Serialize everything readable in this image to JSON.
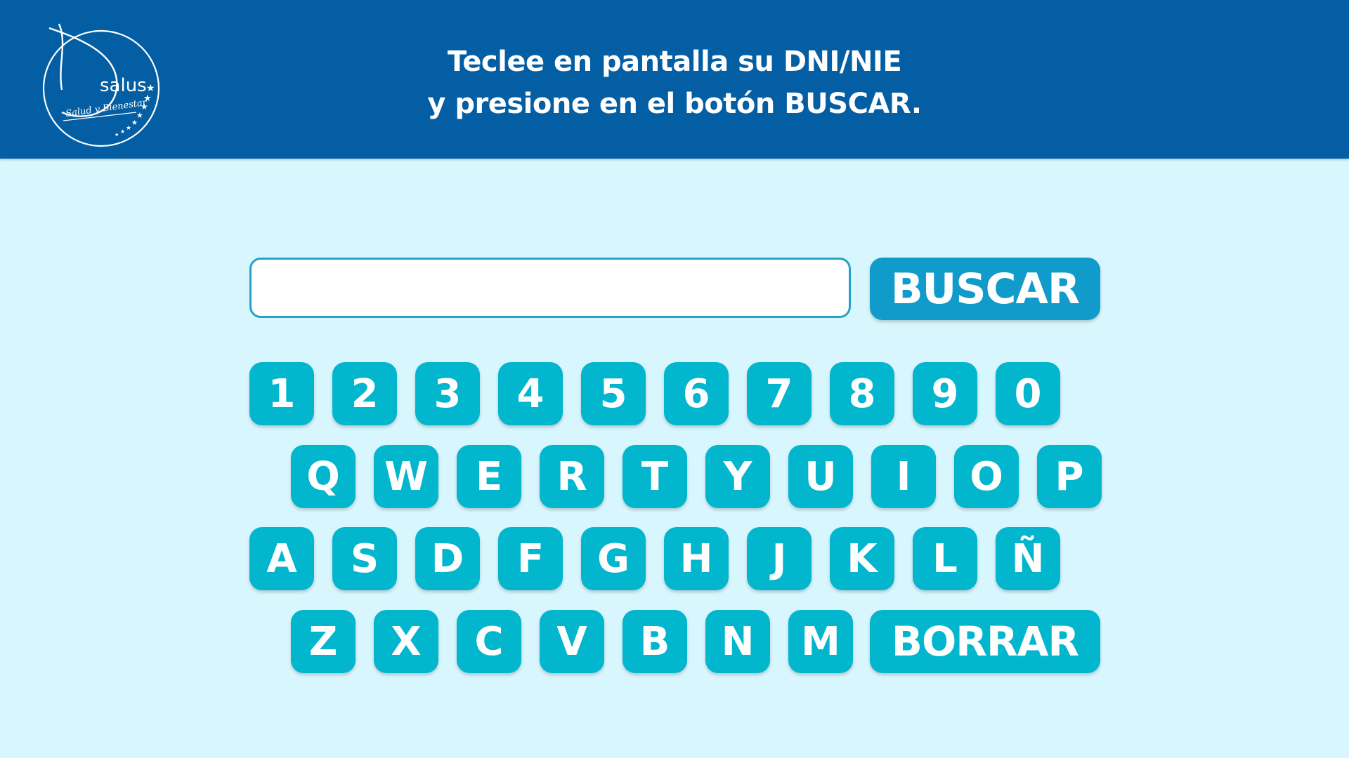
{
  "header": {
    "title_line_1": "Teclee en pantalla su DNI/NIE",
    "title_line_2": "y presione en el botón BUSCAR.",
    "background": "#035ea3"
  },
  "logo": {
    "brand": "salus",
    "tagline": "Salud y Bienestar"
  },
  "search": {
    "value": "",
    "placeholder": "",
    "button_label": "BUSCAR"
  },
  "keyboard": {
    "rows": [
      [
        "1",
        "2",
        "3",
        "4",
        "5",
        "6",
        "7",
        "8",
        "9",
        "0"
      ],
      [
        "Q",
        "W",
        "E",
        "R",
        "T",
        "Y",
        "U",
        "I",
        "O",
        "P"
      ],
      [
        "A",
        "S",
        "D",
        "F",
        "G",
        "H",
        "J",
        "K",
        "L",
        "Ñ"
      ],
      [
        "Z",
        "X",
        "C",
        "V",
        "B",
        "N",
        "M"
      ]
    ],
    "delete_label": "BORRAR"
  },
  "colors": {
    "page_background": "#d8f6fd",
    "key": "#02b6ce",
    "search_button": "#109bcb",
    "input_border": "#24a2c8"
  }
}
